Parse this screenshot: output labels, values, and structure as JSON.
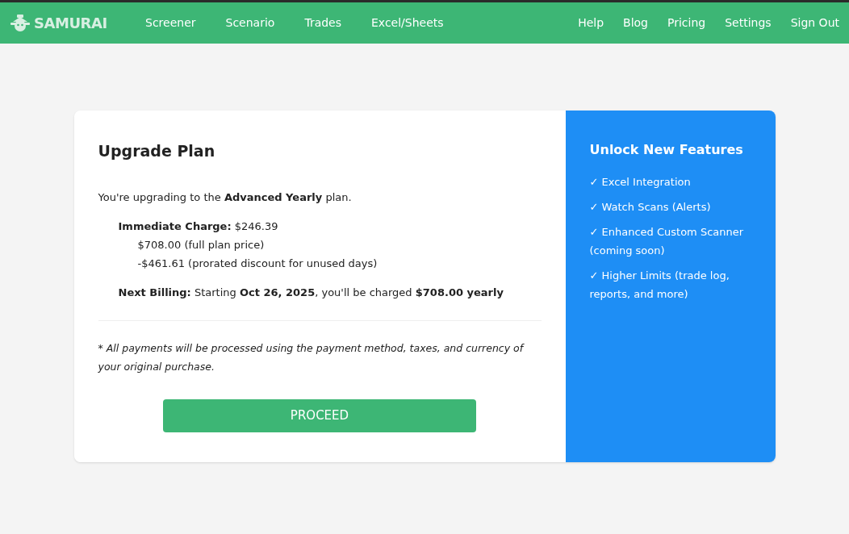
{
  "nav": {
    "logo": "SAMURAI",
    "left_links": [
      "Screener",
      "Scenario",
      "Trades",
      "Excel/Sheets"
    ],
    "right_links": [
      "Help",
      "Blog",
      "Pricing",
      "Settings",
      "Sign Out"
    ]
  },
  "upgrade": {
    "title": "Upgrade Plan",
    "intro": "You're upgrading to the **Advanced Yearly** plan.",
    "charge": "**Immediate Charge:** $246.39",
    "breakdown": [
      "$708.00 (full plan price)",
      "-$461.61 (prorated discount for unused days)"
    ],
    "next_billing": "**Next Billing:** Starting **Oct 26, 2025**, you'll be charged **$708.00 yearly**",
    "note": "* All payments will be processed using the payment method, taxes, and currency of your original purchase.",
    "button": "PROCEED"
  },
  "features": {
    "title": "Unlock New Features",
    "items": [
      "✓ Excel Integration",
      "✓ Watch Scans (Alerts)",
      "✓ Enhanced Custom Scanner (coming soon)",
      "✓ Higher Limits (trade log, reports, and more)"
    ]
  }
}
